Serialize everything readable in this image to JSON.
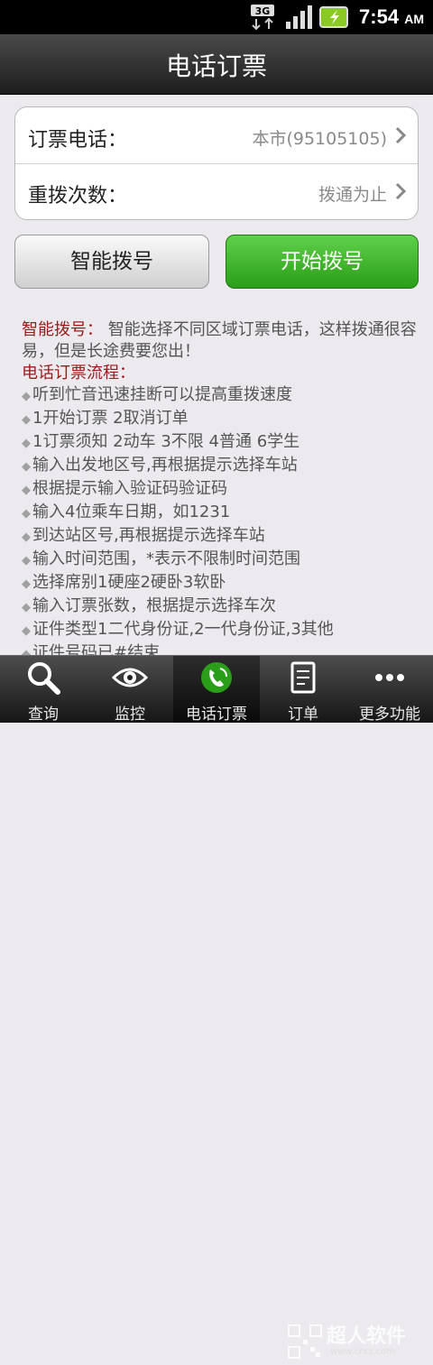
{
  "status_bar": {
    "network": "3G",
    "time": "7:54",
    "ampm": "AM"
  },
  "header": {
    "title": "电话订票"
  },
  "settings": [
    {
      "label": "订票电话：",
      "value": "本市(95105105)"
    },
    {
      "label": "重拨次数：",
      "value": "拨通为止"
    }
  ],
  "buttons": {
    "smart_dial": "智能拨号",
    "start_dial": "开始拨号"
  },
  "info": {
    "smart_title": "智能拨号：",
    "smart_desc": " 智能选择不同区域订票电话，这样拨通很容易，但是长途费要您出！",
    "process_title": "电话订票流程：",
    "steps": [
      "听到忙音迅速挂断可以提高重拨速度",
      "1开始订票 2取消订单",
      "1订票须知 2动车 3不限 4普通 6学生",
      "输入出发地区号,再根据提示选择车站",
      "根据提示输入验证码验证码",
      "输入4位乘车日期，如1231",
      "到达站区号,再根据提示选择车站",
      "输入时间范围，*表示不限制时间范围",
      "选择席别1硬座2硬卧3软卧",
      "输入订票张数，根据提示选择车次",
      "证件类型1二代身份证,2一代身份证,3其他",
      "证件号码已#结束"
    ]
  },
  "tabs": [
    {
      "label": "查询",
      "icon": "search-icon"
    },
    {
      "label": "监控",
      "icon": "eye-icon"
    },
    {
      "label": "电话订票",
      "icon": "phone-icon"
    },
    {
      "label": "订单",
      "icon": "order-icon"
    },
    {
      "label": "更多功能",
      "icon": "more-icon"
    }
  ],
  "watermark": {
    "name": "超人软件",
    "url": "www.crxz.com"
  },
  "colors": {
    "accent_green": "#2a9e18",
    "red_text": "#9b1b1b"
  }
}
